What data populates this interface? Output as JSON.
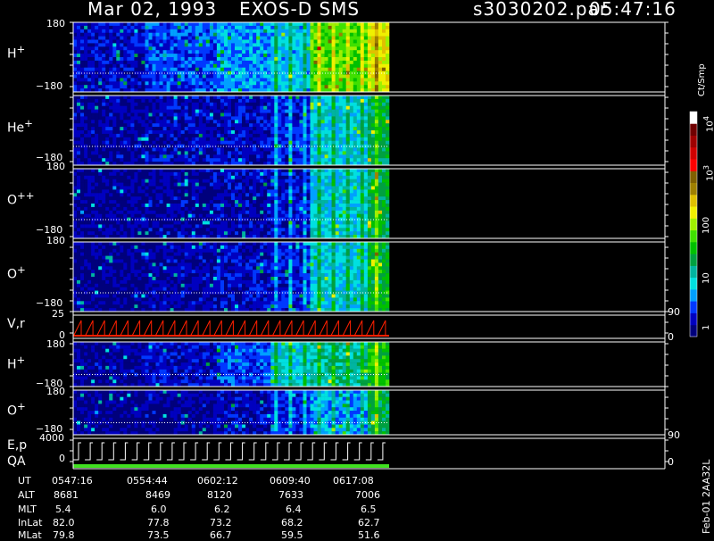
{
  "header": {
    "date": "Mar 02, 1993",
    "instrument": "EXOS-D SMS",
    "file": "s3030202.par",
    "time": "05:47:16"
  },
  "chart_data": {
    "type": "heatmap",
    "panels": [
      {
        "label": "H",
        "sup": "+",
        "ymax": "180",
        "ymin": "−180"
      },
      {
        "label": "He",
        "sup": "+",
        "ymin": "−180"
      },
      {
        "label": "O",
        "sup": "++",
        "ymax": "180",
        "ymin": "−180"
      },
      {
        "label": "O",
        "sup": "+",
        "ymax": "180",
        "ymin": "−180"
      },
      {
        "label": "V,r",
        "ymax": "25",
        "ymin": "0",
        "r_top": "90",
        "r_bot": "0"
      },
      {
        "label": "H",
        "sup": "+",
        "ymax": "180",
        "ymin": "−180"
      },
      {
        "label": "O",
        "sup": "+",
        "ymax": "180",
        "ymin": "−180"
      },
      {
        "label": "E,p",
        "label2": "QA",
        "ymax": "4000",
        "ymin": "0",
        "r_top": "90",
        "r_bot": "0"
      }
    ],
    "colorbar": {
      "title": "Ct/Smp",
      "ticks": [
        "1",
        "10",
        "100",
        "10",
        "10"
      ],
      "tick_sups": [
        "",
        "",
        "",
        "3",
        "4"
      ],
      "colors": [
        "#00007c",
        "#0000c0",
        "#0038ff",
        "#00a0ff",
        "#00e0e0",
        "#00b4a0",
        "#00a040",
        "#00c000",
        "#40e000",
        "#a0f000",
        "#f0f000",
        "#e0c000",
        "#a08000",
        "#806000",
        "#ff0000",
        "#d00000",
        "#a00000",
        "#700000",
        "#ffffff"
      ]
    },
    "footer": {
      "row_labels": [
        "UT",
        "ALT",
        "MLT",
        "InLat",
        "MLat"
      ],
      "columns": [
        [
          "0547:16",
          "8681",
          "5.4",
          "82.0",
          "79.8"
        ],
        [
          "0554:44",
          "8469",
          "6.0",
          "77.8",
          "73.5"
        ],
        [
          "0602:12",
          "8120",
          "6.2",
          "73.2",
          "66.7"
        ],
        [
          "0609:40",
          "7633",
          "6.4",
          "68.2",
          "59.5"
        ],
        [
          "0617:08",
          "7006",
          "6.5",
          "62.7",
          "51.6"
        ]
      ]
    },
    "side_text": "Feb-01 2AA32L"
  }
}
